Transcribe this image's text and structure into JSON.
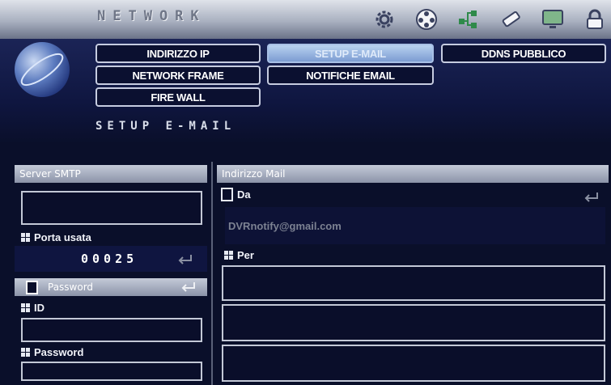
{
  "header": {
    "title": "NETWORK"
  },
  "top_icons": [
    "gear-icon",
    "film-reel-icon",
    "network-icon",
    "usb-stick-icon",
    "monitor-icon",
    "lock-icon"
  ],
  "tabs": [
    {
      "label": "INDIRIZZO IP",
      "active": false
    },
    {
      "label": "SETUP E-MAIL",
      "active": true
    },
    {
      "label": "DDNS PUBBLICO",
      "active": false
    },
    {
      "label": "NETWORK FRAME",
      "active": false
    },
    {
      "label": "NOTIFICHE EMAIL",
      "active": false
    },
    {
      "label": "FIRE WALL",
      "active": false
    }
  ],
  "section_title": "SETUP E-MAIL",
  "left_panel": {
    "header": "Server SMTP",
    "server_value": "",
    "port_label": "Porta usata",
    "port_value": "00025",
    "password_toggle_label": "Password",
    "id_label": "ID",
    "id_value": "",
    "password_label": "Password",
    "password_value": ""
  },
  "right_panel": {
    "header": "Indirizzo Mail",
    "from_label": "Da",
    "from_value": "DVRnotify@gmail.com",
    "to_label": "Per",
    "to_values": [
      "",
      "",
      ""
    ]
  },
  "colors": {
    "background": "#0a0f2a",
    "header_bar": "#a9b0c0",
    "active_tab": "#9db8e6",
    "panel_header": "#aab1c2"
  }
}
